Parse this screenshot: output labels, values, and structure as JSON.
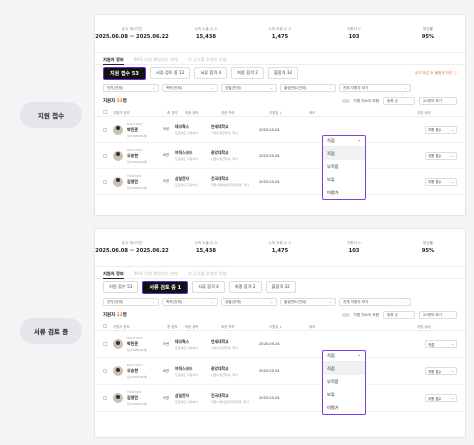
{
  "sections": [
    {
      "side_label": "지원 접수",
      "stats": [
        {
          "label": "공고 게시기간",
          "value": "2025.06.08 ~ 2025.06.22"
        },
        {
          "label": "누적 노출 수 ⊙",
          "value": "15,438"
        },
        {
          "label": "누적 조회 수 ⊙",
          "value": "1,475"
        },
        {
          "label": "지원자 ⊙",
          "value": "103"
        },
        {
          "label": "응답률",
          "value": "95%"
        }
      ],
      "top_tabs": [
        "지원자 정보",
        "96% 지원 예정자는 현재",
        "이 공고를 조회한 인재"
      ],
      "status_tabs": [
        "지원 접수 53",
        "서류 검토 중 12",
        "서류 합격 4",
        "최종 합격 2",
        "불합격 32"
      ],
      "active_status": 0,
      "note": "공고 마감 후 불합격 처리 ⓘ",
      "filters": [
        "연차(전체)",
        "학력(전체)",
        "성별(전체)",
        "출생연도(전체)",
        "전체 지원자 보기"
      ],
      "count_label": "지원자 ",
      "count_num": "53",
      "count_unit": "명",
      "toggle_label": "지원 취소자 포함",
      "sort": "등록 순",
      "perpage": "20명씩 보기",
      "headers": [
        "지원자 정보",
        "총 경력",
        "최종 경력",
        "최종 학력",
        "지원일 ↓",
        "메모",
        "지원 상태"
      ],
      "rows": [
        {
          "id": "BAD31867",
          "name": "박민준",
          "sub": "남/1998(25세)",
          "exp": "5년",
          "co": "테크웍스",
          "co_sub": "프로덕트 디자이너",
          "sch": "연세대학교",
          "sch_sub": "시각디자인학과, 학사",
          "date": "2025.05.24",
          "memo": "",
          "status": "지원 접수"
        },
        {
          "id": "BAD31867",
          "name": "오승현",
          "sub": "남/1996(28세)",
          "exp": "6년",
          "co": "브릭스코드",
          "co_sub": "프로덕트 디자이너",
          "sch": "중앙대학교",
          "sch_sub": "산업디자인학과, 학사",
          "date": "2025.05.24",
          "memo": "",
          "status": "지원 접수"
        },
        {
          "id": "TWP6288",
          "name": "김영민",
          "sub": "남/1998(25세)",
          "exp": "5년",
          "co": "삼일전자",
          "co_sub": "프로덕트 디자이너",
          "sch": "건국대학교",
          "sch_sub": "커뮤니케이션디자인학과, 학사",
          "date": "2025.05.24",
          "memo": "",
          "status": "지원 접수"
        }
      ],
      "dropdown": {
        "selected": "직접",
        "items": [
          "직접",
          "부적합",
          "보류",
          "미평가"
        ]
      }
    },
    {
      "side_label": "서류 검토 중",
      "stats": [
        {
          "label": "공고 게시기간",
          "value": "2025.06.08 ~ 2025.06.22"
        },
        {
          "label": "누적 노출 수 ⊙",
          "value": "15,438"
        },
        {
          "label": "누적 조회 수 ⊙",
          "value": "1,475"
        },
        {
          "label": "지원자 ⊙",
          "value": "103"
        },
        {
          "label": "응답률",
          "value": "95%"
        }
      ],
      "top_tabs": [
        "지원자 정보",
        "96% 지원 예정자는 현재",
        "이 공고를 조회한 인재"
      ],
      "status_tabs": [
        "지원 접수 53",
        "서류 검토 중 1",
        "서류 합격 4",
        "최종 합격 2",
        "불합격 32"
      ],
      "active_status": 1,
      "note": "",
      "filters": [
        "연차(전체)",
        "학력(전체)",
        "성별(전체)",
        "출생연도(전체)",
        "전체 지원자 보기"
      ],
      "count_label": "지원자 ",
      "count_num": "12",
      "count_unit": "명",
      "toggle_label": "지원 취소자 포함",
      "sort": "등록 순",
      "perpage": "20명씩 보기",
      "headers": [
        "지원자 정보",
        "총 경력",
        "최종 경력",
        "최종 학력",
        "지원일 ↓",
        "메모",
        "지원 상태"
      ],
      "rows": [
        {
          "id": "BAD31867",
          "name": "박민준",
          "sub": "남/1998(25세)",
          "exp": "5년",
          "co": "테크웍스",
          "co_sub": "프로덕트 디자이너",
          "sch": "연세대학교",
          "sch_sub": "시각디자인학과, 학사",
          "date": "2025.05.24",
          "memo": "",
          "status": "직접"
        },
        {
          "id": "BAD31867",
          "name": "오승현",
          "sub": "남/1996(28세)",
          "exp": "6년",
          "co": "브릭스코드",
          "co_sub": "프로덕트 디자이너",
          "sch": "중앙대학교",
          "sch_sub": "산업디자인학과, 학사",
          "date": "2025.05.24",
          "memo": "",
          "status": "지원 접수"
        },
        {
          "id": "TWP6288",
          "name": "김영민",
          "sub": "남/1998(25세)",
          "exp": "5년",
          "co": "삼일전자",
          "co_sub": "프로덕트 디자이너",
          "sch": "건국대학교",
          "sch_sub": "커뮤니케이션디자인학과, 학사",
          "date": "2025.05.24",
          "memo": "",
          "status": "지원 접수"
        }
      ],
      "dropdown": {
        "selected": "직접",
        "items": [
          "직접",
          "부적합",
          "보류",
          "미평가"
        ]
      }
    }
  ]
}
